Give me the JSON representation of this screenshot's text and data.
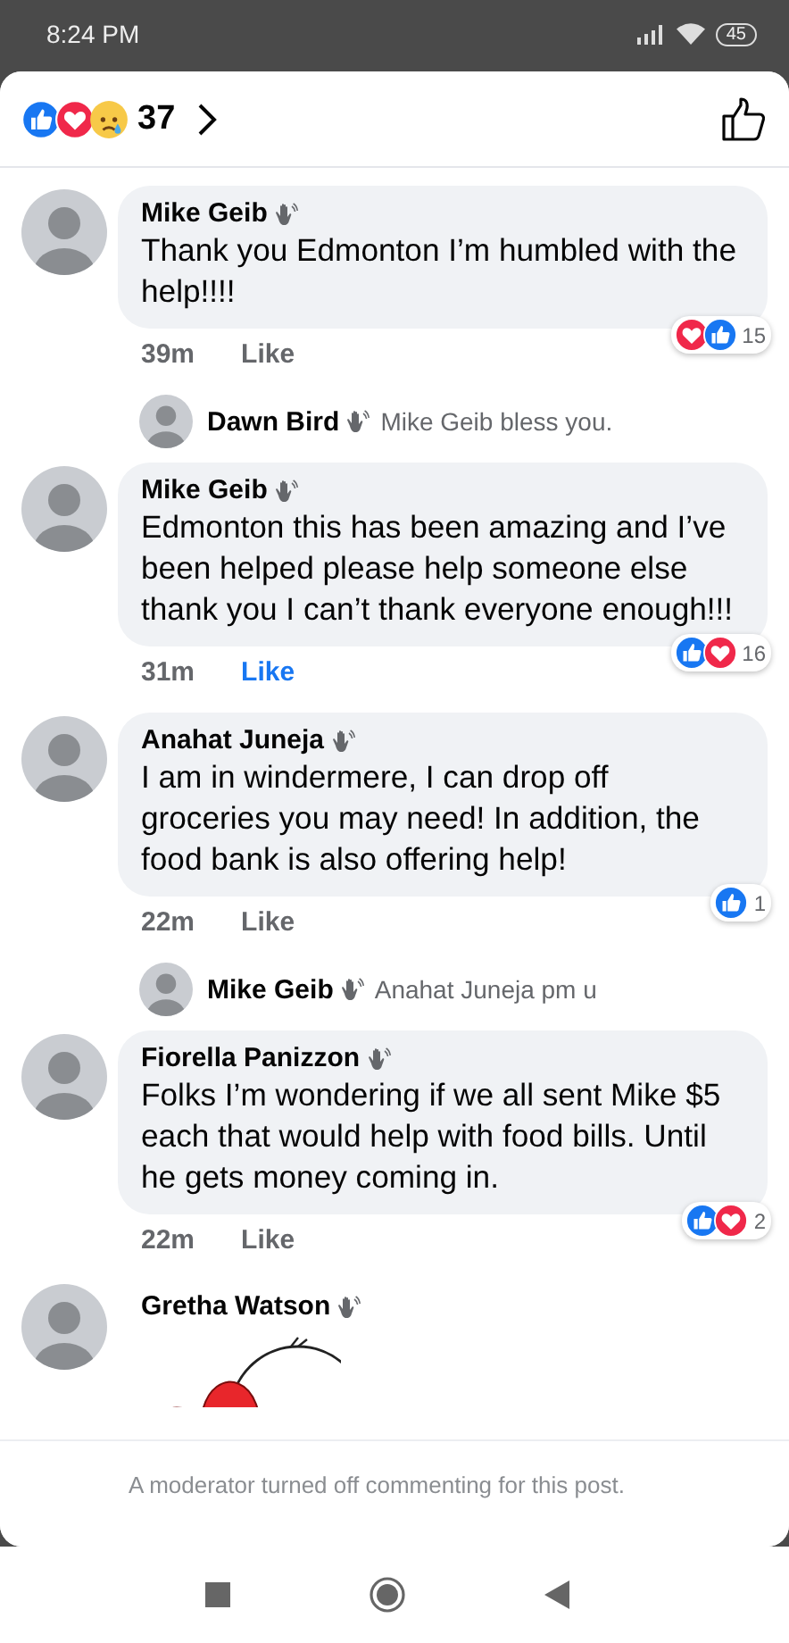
{
  "status_bar": {
    "time": "8:24 PM",
    "battery": "45"
  },
  "header": {
    "reactions": [
      {
        "kind": "like"
      },
      {
        "kind": "love"
      },
      {
        "kind": "sad"
      }
    ],
    "count": "37"
  },
  "comments": [
    {
      "kind": "comment",
      "author": "Mike Geib",
      "text": "Thank you Edmonton I’m humbled with the help!!!!",
      "time": "39m",
      "like": "Like",
      "liked": false,
      "reactions": [
        {
          "kind": "love"
        },
        {
          "kind": "like"
        }
      ],
      "reaction_count": "15"
    },
    {
      "kind": "reply",
      "author": "Dawn Bird",
      "text": "Mike Geib bless you."
    },
    {
      "kind": "comment",
      "author": "Mike Geib",
      "text": "Edmonton this has been amazing and I’ve been helped please help someone else thank you I can’t thank everyone enough!!!",
      "time": "31m",
      "like": "Like",
      "liked": true,
      "reactions": [
        {
          "kind": "like"
        },
        {
          "kind": "love"
        }
      ],
      "reaction_count": "16"
    },
    {
      "kind": "comment",
      "author": "Anahat Juneja",
      "text": "I am in windermere, I can drop off groceries you may need! In addition, the food bank is also offering help!",
      "time": "22m",
      "like": "Like",
      "liked": false,
      "reactions": [
        {
          "kind": "like"
        }
      ],
      "reaction_count": "1"
    },
    {
      "kind": "reply",
      "author": "Mike Geib",
      "text": "Anahat Juneja pm u"
    },
    {
      "kind": "comment",
      "author": "Fiorella Panizzon",
      "text": "Folks I’m wondering if we all sent Mike $5 each that would help with food bills. Until he gets money coming in.",
      "time": "22m",
      "like": "Like",
      "liked": false,
      "reactions": [
        {
          "kind": "like"
        },
        {
          "kind": "love"
        }
      ],
      "reaction_count": "2"
    },
    {
      "kind": "sticker",
      "author": "Gretha Watson"
    }
  ],
  "footer": {
    "notice": "A moderator turned off commenting for this post."
  }
}
